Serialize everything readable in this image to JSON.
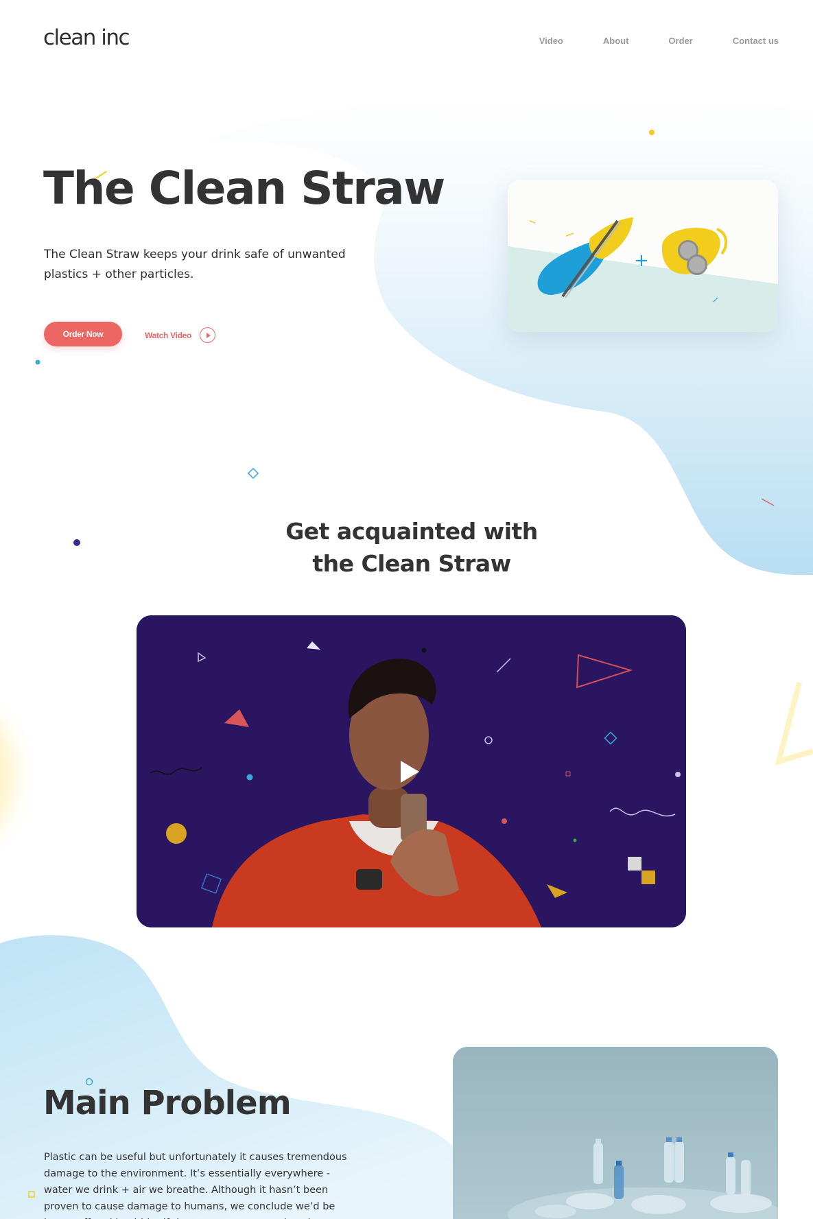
{
  "header": {
    "logo": "clean inc",
    "nav": [
      {
        "label": "Video"
      },
      {
        "label": "About"
      },
      {
        "label": "Order"
      },
      {
        "label": "Contact us"
      }
    ]
  },
  "hero": {
    "title": "The Clean Straw",
    "description": "The Clean Straw keeps your drink safe of unwanted plastics + other particles.",
    "order_button": "Order Now",
    "watch_button": "Watch Video",
    "illustration_symbol": "+"
  },
  "acquaint": {
    "title_line1": "Get acquainted with",
    "title_line2": "the Clean Straw"
  },
  "problem": {
    "title": "Main Problem",
    "description": "Plastic can be useful but unfortunately it causes tremendous damage to the environment. It’s essentially everywhere - water we drink + air we breathe. Although it hasn’t been proven to cause damage to humans, we conclude we’d be better off and healthier if there was a way to reduce it."
  },
  "colors": {
    "accent": "#ec6664",
    "text": "#333333",
    "nav": "#9a9a9a",
    "sky_blue": "#bfe3f5",
    "video_bg": "#2a1660",
    "yellow": "#f2cd1c"
  },
  "icons": [
    "play-circle-icon",
    "video-play-icon"
  ]
}
